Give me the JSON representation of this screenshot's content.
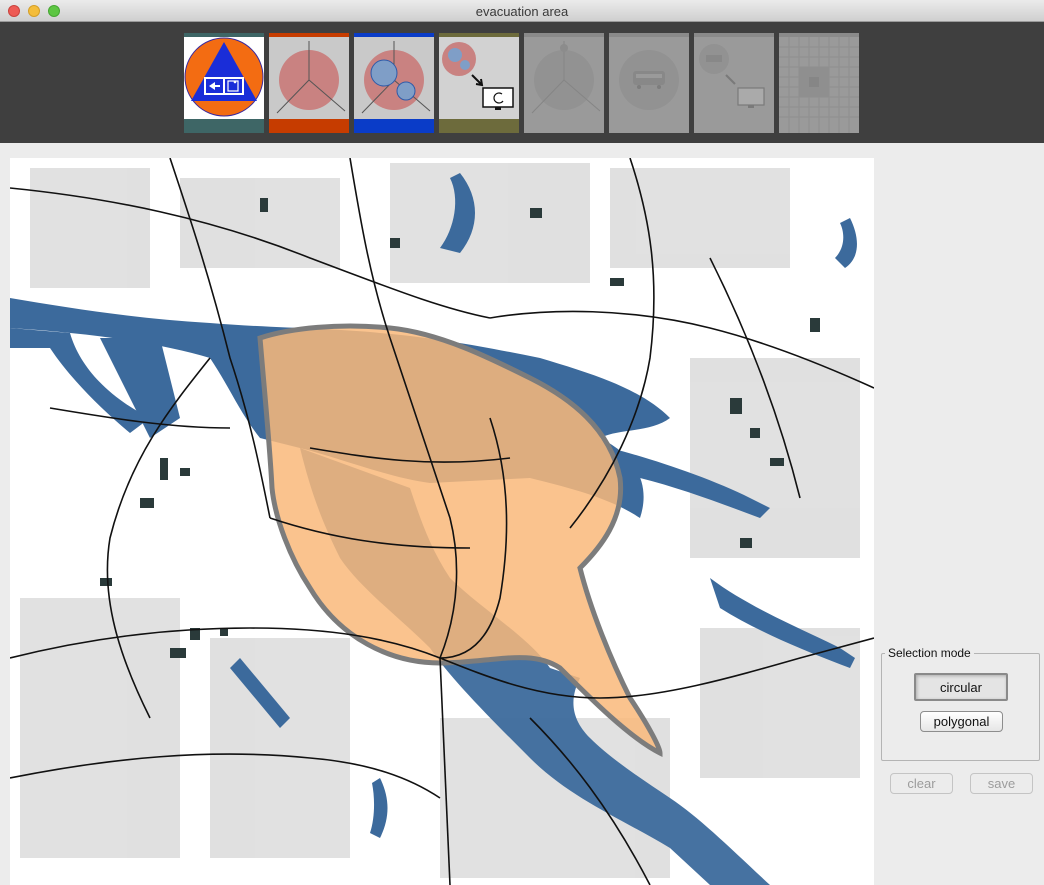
{
  "window": {
    "title": "evacuation area"
  },
  "toolbar": {
    "tools": [
      {
        "name": "evacuation-sign",
        "accent": "#3e6666",
        "state": "enabled"
      },
      {
        "name": "circle-selection",
        "accent": "#c63c00",
        "state": "enabled"
      },
      {
        "name": "multi-circle-selection",
        "accent": "#0a3cc8",
        "state": "enabled"
      },
      {
        "name": "export-to-screen",
        "accent": "#6d6b3c",
        "state": "enabled"
      },
      {
        "name": "sector-view",
        "accent": "#9a9a9a",
        "state": "disabled"
      },
      {
        "name": "transport",
        "accent": "#9a9a9a",
        "state": "disabled"
      },
      {
        "name": "export-small",
        "accent": "#9a9a9a",
        "state": "disabled"
      },
      {
        "name": "grid-view",
        "accent": "#9a9a9a",
        "state": "disabled"
      }
    ]
  },
  "selection_panel": {
    "title": "Selection mode",
    "circular_label": "circular",
    "polygonal_label": "polygonal",
    "active_mode": "circular"
  },
  "actions": {
    "clear_label": "clear",
    "save_label": "save",
    "enabled": false
  },
  "map": {
    "water_color": "#3c6a9c",
    "selection_fill": "#f9b97a",
    "selection_outline": "#7c7c7c"
  }
}
